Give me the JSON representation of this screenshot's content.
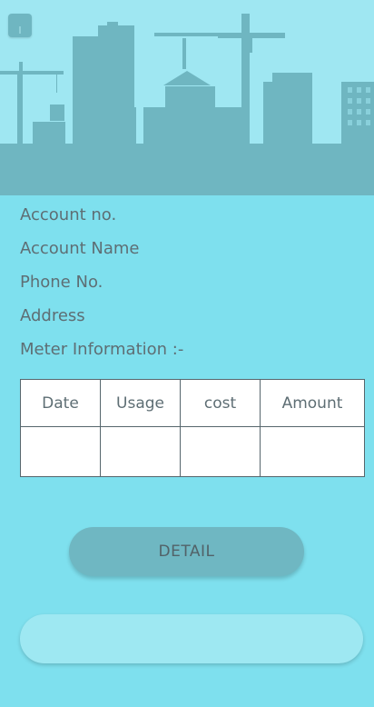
{
  "account": {
    "account_no_label": "Account no.",
    "account_name_label": "Account Name",
    "phone_label": "Phone No.",
    "address_label": "Address",
    "meter_label": "Meter Information :-"
  },
  "table": {
    "headers": [
      "Date",
      "Usage",
      "cost",
      "Amount"
    ],
    "rows": [
      [
        "",
        "",
        "",
        ""
      ]
    ]
  },
  "actions": {
    "detail_label": "DETAIL",
    "bottom_field_value": ""
  },
  "colors": {
    "background": "#7ee0ee",
    "banner": "#9fe7f2",
    "silhouette": "#6fb6c1",
    "button": "#6fb7c2"
  }
}
